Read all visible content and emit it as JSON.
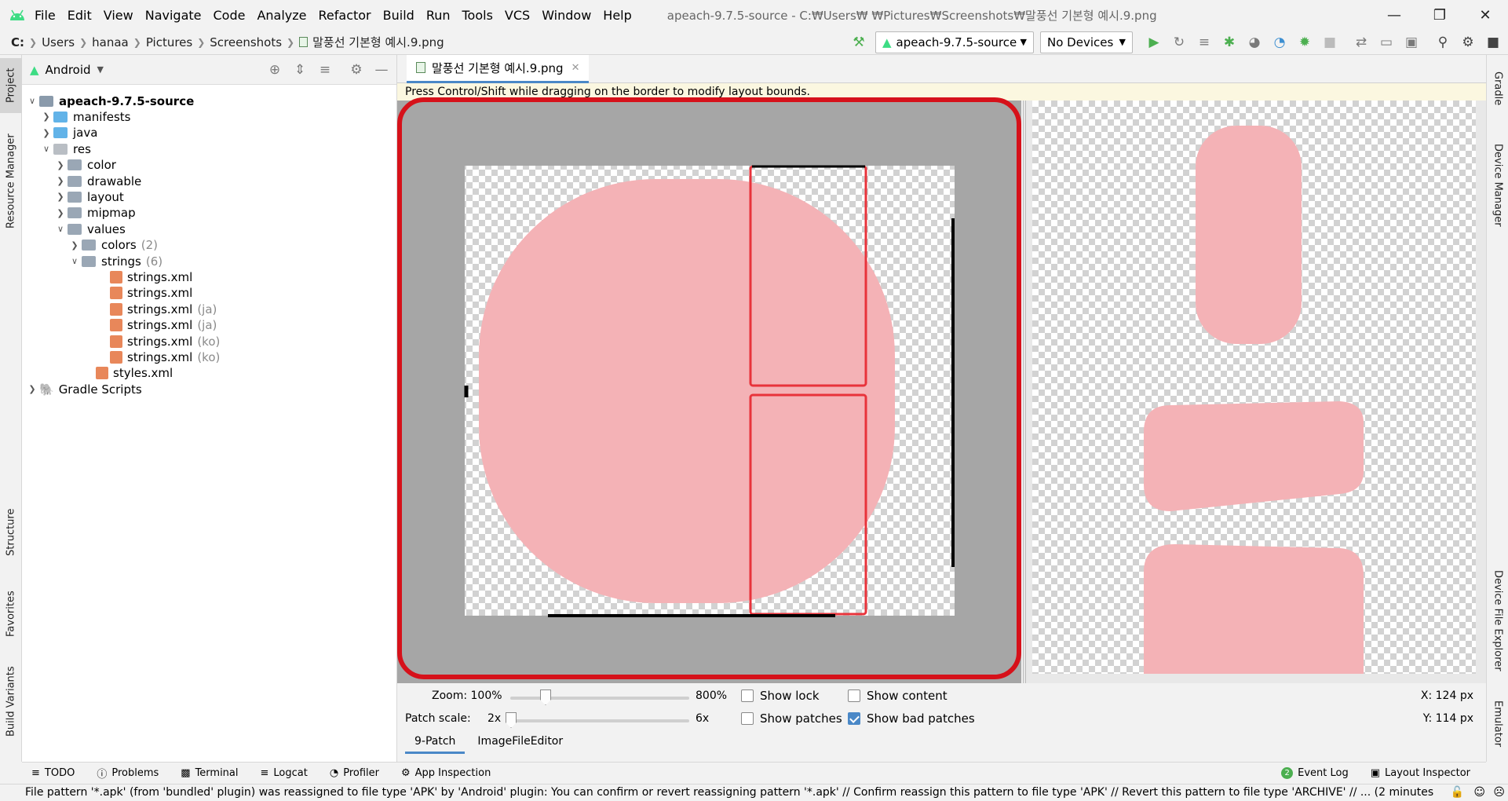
{
  "menu": [
    "File",
    "Edit",
    "View",
    "Navigate",
    "Code",
    "Analyze",
    "Refactor",
    "Build",
    "Run",
    "Tools",
    "VCS",
    "Window",
    "Help"
  ],
  "window_title": "apeach-9.7.5-source - C:₩Users₩          ₩Pictures₩Screenshots₩말풍선 기본형 예시.9.png",
  "breadcrumb": [
    "C:",
    "Users",
    "hanaa",
    "Pictures",
    "Screenshots",
    "말풍선 기본형 예시.9.png"
  ],
  "toolbar": {
    "run_config": "apeach-9.7.5-source",
    "device": "No Devices"
  },
  "left_tabs": [
    "Project",
    "Resource Manager",
    "Structure",
    "Favorites",
    "Build Variants"
  ],
  "right_tabs": [
    "Gradle",
    "Device Manager",
    "Device File Explorer",
    "Emulator"
  ],
  "project_panel": {
    "view": "Android"
  },
  "tree": [
    {
      "label": "apeach-9.7.5-source",
      "bold": true,
      "indent": 0,
      "arrow": "v",
      "icon": "module"
    },
    {
      "label": "manifests",
      "indent": 1,
      "arrow": ">",
      "icon": "folder-blue"
    },
    {
      "label": "java",
      "indent": 1,
      "arrow": ">",
      "icon": "folder-blue"
    },
    {
      "label": "res",
      "indent": 1,
      "arrow": "v",
      "icon": "folder-res"
    },
    {
      "label": "color",
      "indent": 2,
      "arrow": ">",
      "icon": "folder"
    },
    {
      "label": "drawable",
      "indent": 2,
      "arrow": ">",
      "icon": "folder"
    },
    {
      "label": "layout",
      "indent": 2,
      "arrow": ">",
      "icon": "folder"
    },
    {
      "label": "mipmap",
      "indent": 2,
      "arrow": ">",
      "icon": "folder"
    },
    {
      "label": "values",
      "indent": 2,
      "arrow": "v",
      "icon": "folder"
    },
    {
      "label": "colors",
      "count": "(2)",
      "indent": 3,
      "arrow": ">",
      "icon": "folder"
    },
    {
      "label": "strings",
      "count": "(6)",
      "indent": 3,
      "arrow": "v",
      "icon": "folder"
    },
    {
      "label": "strings.xml",
      "indent": 5,
      "icon": "xml"
    },
    {
      "label": "strings.xml",
      "indent": 5,
      "icon": "xml"
    },
    {
      "label": "strings.xml",
      "count": "(ja)",
      "indent": 5,
      "icon": "xml"
    },
    {
      "label": "strings.xml",
      "count": "(ja)",
      "indent": 5,
      "icon": "xml"
    },
    {
      "label": "strings.xml",
      "count": "(ko)",
      "indent": 5,
      "icon": "xml"
    },
    {
      "label": "strings.xml",
      "count": "(ko)",
      "indent": 5,
      "icon": "xml"
    },
    {
      "label": "styles.xml",
      "indent": 4,
      "icon": "xml"
    },
    {
      "label": "Gradle Scripts",
      "indent": 0,
      "arrow": ">",
      "icon": "gradle"
    }
  ],
  "editor": {
    "tab": "말풍선 기본형 예시.9.png",
    "hint": "Press Control/Shift while dragging on the border to modify layout bounds."
  },
  "controls": {
    "zoom_label": "Zoom: 100%",
    "zoom_max": "800%",
    "patch_label": "Patch scale:",
    "patch_min": "2x",
    "patch_max": "6x",
    "show_lock": "Show lock",
    "show_patches": "Show patches",
    "show_content": "Show content",
    "show_bad_patches": "Show bad patches",
    "x_coord": "X: 124 px",
    "y_coord": "Y: 114 px",
    "bottom_tabs": [
      "9-Patch",
      "ImageFileEditor"
    ]
  },
  "checkbox_states": {
    "show_lock": false,
    "show_patches": false,
    "show_content": false,
    "show_bad_patches": true
  },
  "tool_windows": [
    "TODO",
    "Problems",
    "Terminal",
    "Logcat",
    "Profiler",
    "App Inspection"
  ],
  "tool_windows_right": [
    "Event Log",
    "Layout Inspector"
  ],
  "event_log_count": "2",
  "status": "File pattern '*.apk' (from 'bundled' plugin) was reassigned to file type 'APK' by 'Android' plugin: You can confirm or revert reassigning pattern '*.apk' // Confirm reassign this pattern to file type 'APK' // Revert this pattern to file type 'ARCHIVE' // ... (2 minutes",
  "colors": {
    "accent": "#4a88c7",
    "pink": "#f4b2b6",
    "patch_red": "#e8333b",
    "highlight": "#d6111a"
  }
}
